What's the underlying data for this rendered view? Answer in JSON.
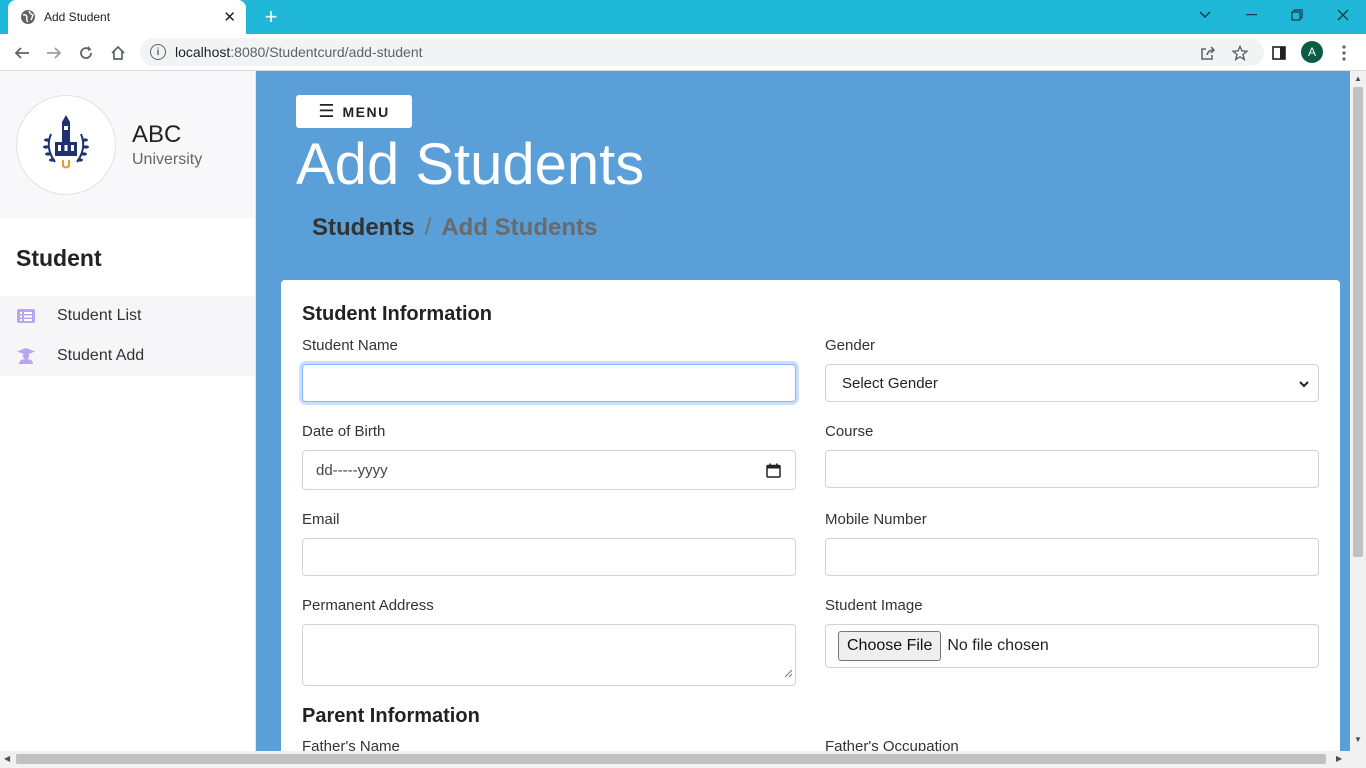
{
  "browser": {
    "tab_title": "Add Student",
    "url_host": "localhost",
    "url_path": ":8080/Studentcurd/add-student",
    "profile_initial": "A",
    "accent_color": "#1fb8d9"
  },
  "sidebar": {
    "brand_name": "ABC",
    "brand_sub": "University",
    "section_title": "Student",
    "items": [
      {
        "label": "Student List",
        "icon": "list-icon"
      },
      {
        "label": "Student Add",
        "icon": "graduate-icon"
      }
    ],
    "icon_color": "#b9a6f0"
  },
  "header": {
    "menu_label": "MENU",
    "page_title": "Add Students",
    "breadcrumb": {
      "parent": "Students",
      "separator": "/",
      "current": "Add Students"
    },
    "background_color": "#5a9fd8"
  },
  "form": {
    "student_section_title": "Student Information",
    "student_name": {
      "label": "Student Name",
      "value": ""
    },
    "gender": {
      "label": "Gender",
      "selected": "Select Gender"
    },
    "dob": {
      "label": "Date of Birth",
      "placeholder": "dd-----yyyy"
    },
    "course": {
      "label": "Course",
      "value": ""
    },
    "email": {
      "label": "Email",
      "value": ""
    },
    "mobile": {
      "label": "Mobile Number",
      "value": ""
    },
    "address": {
      "label": "Permanent Address",
      "value": ""
    },
    "image": {
      "label": "Student Image",
      "button": "Choose File",
      "status": "No file chosen"
    },
    "parent_section_title": "Parent Information",
    "father_name": {
      "label": "Father's Name"
    },
    "father_occupation": {
      "label": "Father's Occupation"
    }
  }
}
